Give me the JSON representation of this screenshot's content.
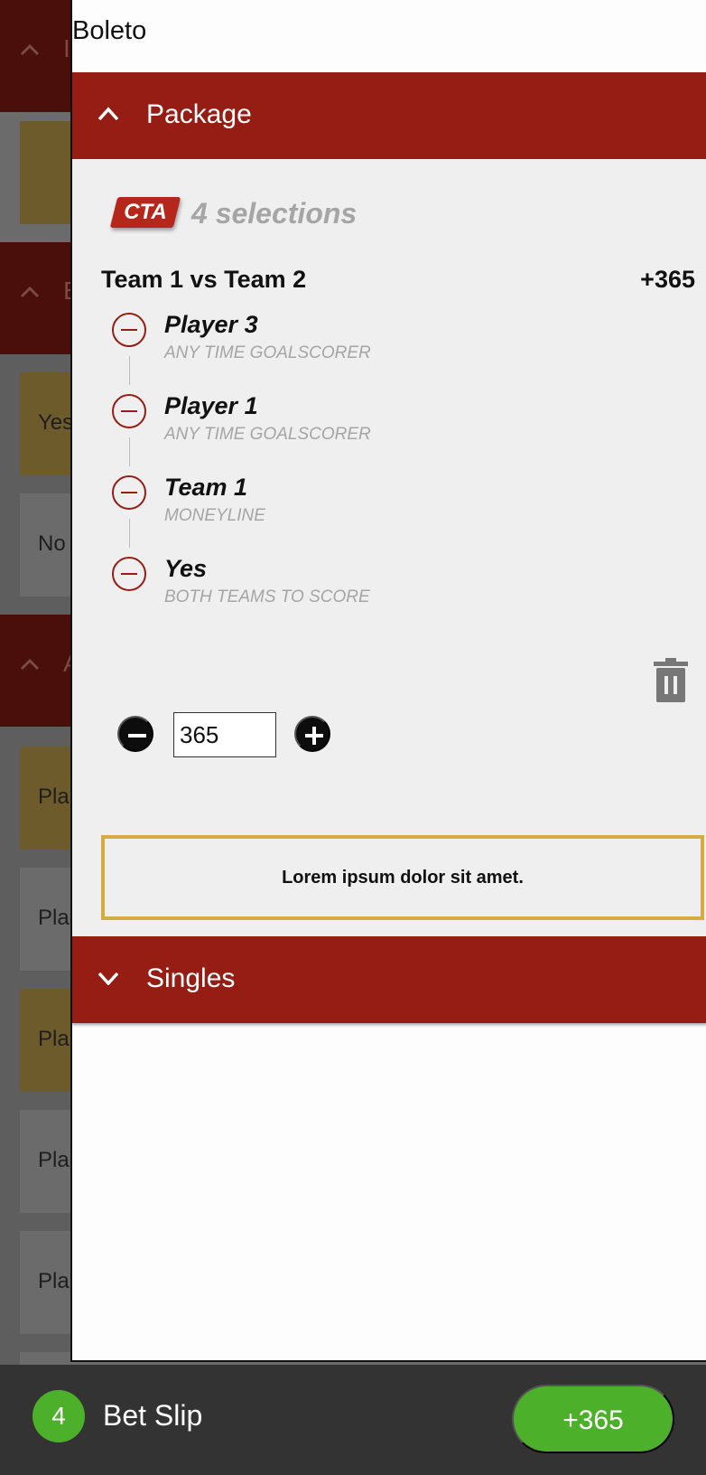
{
  "background_page": {
    "header_peek_1": "I",
    "header_peek_2": "E",
    "header_peek_3": "A",
    "cards": [
      "Yes",
      "No",
      "Pla",
      "Pla",
      "Pla",
      "Pla",
      "Pla"
    ]
  },
  "drawer": {
    "title": "Boleto",
    "package_section": {
      "label": "Package",
      "expanded": true,
      "badge": "CTA",
      "selection_count": "4 selections",
      "match": {
        "title": "Team 1 vs Team 2",
        "odds": "+365"
      },
      "legs": [
        {
          "name": "Player 3",
          "market": "ANY TIME GOALSCORER"
        },
        {
          "name": "Player 1",
          "market": "ANY TIME GOALSCORER"
        },
        {
          "name": "Team 1",
          "market": "MONEYLINE"
        },
        {
          "name": "Yes",
          "market": "BOTH TEAMS TO SCORE"
        }
      ],
      "stake_value": "365",
      "notice": "Lorem ipsum dolor sit amet."
    },
    "singles_section": {
      "label": "Singles",
      "expanded": false
    }
  },
  "bet_slip_bar": {
    "count": "4",
    "label": "Bet Slip",
    "odds": "+365"
  },
  "colors": {
    "section_red": "#951d14",
    "badge_red": "#b5261b",
    "accent_green": "#4db02a",
    "notice_border_gold": "#d6ab42",
    "slip_bar_bg": "#333333"
  },
  "icons": [
    "chevron-up-icon",
    "chevron-down-icon",
    "remove-leg-icon",
    "trash-icon",
    "minus-icon",
    "plus-icon"
  ]
}
